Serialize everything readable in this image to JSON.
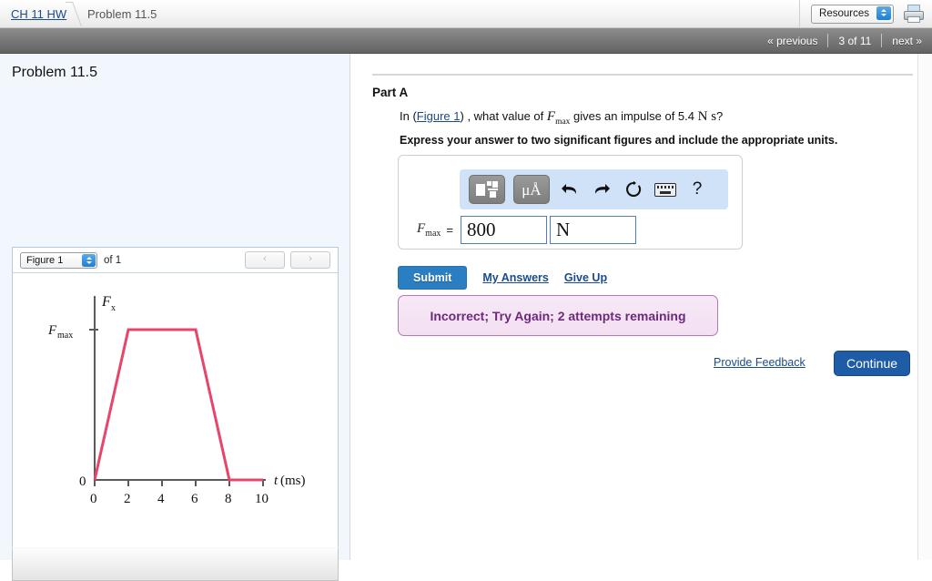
{
  "topbar": {
    "breadcrumb_link": "CH 11 HW",
    "breadcrumb_current": "Problem 11.5",
    "resources_label": "Resources",
    "print_icon": "printer-icon"
  },
  "nav": {
    "previous": "« previous",
    "page_indicator": "3 of 11",
    "next": "next »"
  },
  "sidebar": {
    "problem_title": "Problem 11.5",
    "figure_select_value": "Figure 1",
    "figure_of_label": "of 1",
    "prev_arrow": "‹",
    "next_arrow": "›"
  },
  "main": {
    "part_title": "Part A",
    "question_prefix": "In (",
    "question_figure_link": "Figure 1",
    "question_mid": ") , what value of ",
    "question_var": "F",
    "question_var_sub": "max",
    "question_tail": " gives an impulse of 5.4 ",
    "question_units": "N s",
    "question_end": "?",
    "instruction": "Express your answer to two significant figures and include the appropriate units.",
    "answer_label_var": "F",
    "answer_label_sub": "max",
    "equals": "=",
    "answer_value": "800",
    "answer_unit": "N",
    "submit_label": "Submit",
    "my_answers_label": "My Answers",
    "give_up_label": "Give Up",
    "feedback_message": "Incorrect; Try Again; 2 attempts remaining",
    "provide_feedback_label": "Provide Feedback",
    "continue_label": "Continue"
  },
  "toolbar": {
    "template_icon": "math-template-icon",
    "units_icon": "μÅ",
    "undo_icon": "undo-arrow-icon",
    "redo_icon": "redo-arrow-icon",
    "reset_icon": "reset-circle-icon",
    "keyboard_icon": "keyboard-icon",
    "help_icon": "?"
  },
  "colors": {
    "accent_blue": "#2b7ec1",
    "continue_blue": "#1f5ca8",
    "curve_pink": "#e8456b",
    "feedback_purple": "#6b2a7a",
    "panel_bg": "#f2f7fd"
  },
  "chart_data": {
    "type": "line",
    "title": "",
    "xlabel": "t (ms)",
    "ylabel": "F_x",
    "x": [
      0,
      2,
      6,
      8,
      10
    ],
    "y": [
      0,
      1,
      1,
      0,
      0
    ],
    "y_value_labels": [
      "0",
      "F_max"
    ],
    "xticks": [
      0,
      2,
      4,
      6,
      8,
      10
    ],
    "xtick_labels": [
      "0",
      "2",
      "4",
      "6",
      "8",
      "10"
    ],
    "yticks": [
      0,
      1
    ],
    "ytick_labels": [
      "0",
      "F_max"
    ],
    "xlim": [
      0,
      11
    ],
    "ylim": [
      0,
      1.35
    ],
    "grid": false,
    "legend": false,
    "series_color": "#e8456b",
    "description": "Trapezoidal force pulse: rises linearly from 0 at t=0 to F_max at t=2 ms, constant at F_max from 2 to 6 ms, falls linearly to 0 at t=8 ms, remains 0 to 10 ms."
  }
}
